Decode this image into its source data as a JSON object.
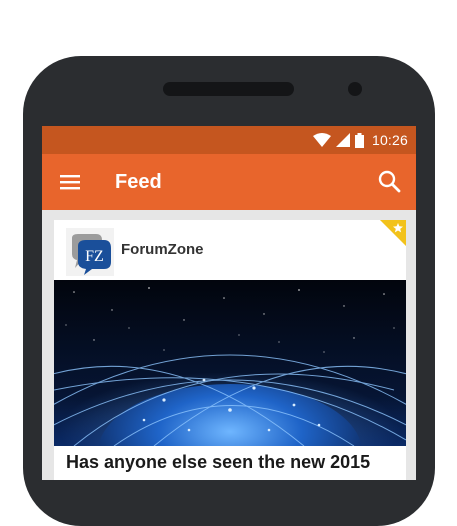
{
  "status_bar": {
    "time": "10:26"
  },
  "app_bar": {
    "title": "Feed"
  },
  "feed": {
    "items": [
      {
        "source": {
          "name": "ForumZone",
          "logo_text": "FZ"
        },
        "title": "Has anyone else seen the new 2015"
      }
    ]
  },
  "colors": {
    "app_bar": "#e8652c",
    "status_bar": "#c5561f",
    "badge": "#f2c21b",
    "background": "#e6e6e6"
  }
}
